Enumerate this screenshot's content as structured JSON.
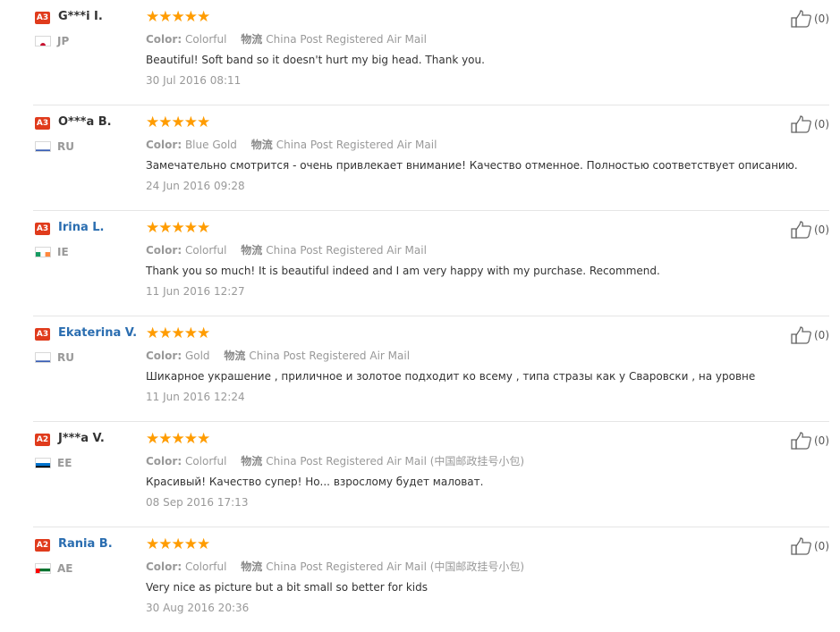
{
  "labels": {
    "color": "Color:",
    "ship_icon": "物流"
  },
  "reviews": [
    {
      "badge": "A3",
      "name": "G***i I.",
      "linked": false,
      "flag": "jp",
      "country": "JP",
      "stars": "★★★★★",
      "color": "Colorful",
      "shipping": "China Post Registered Air Mail",
      "text": "Beautiful! Soft band so it doesn't hurt my big head. Thank you.",
      "date": "30 Jul 2016 08:11",
      "likes": "(0)"
    },
    {
      "badge": "A3",
      "name": "O***a B.",
      "linked": false,
      "flag": "ru",
      "country": "RU",
      "stars": "★★★★★",
      "color": "Blue Gold",
      "shipping": "China Post Registered Air Mail",
      "text": "Замечательно смотрится - очень привлекает внимание! Качество отменное. Полностью соответствует описанию.",
      "date": "24 Jun 2016 09:28",
      "likes": "(0)"
    },
    {
      "badge": "A3",
      "name": "Irina L.",
      "linked": true,
      "flag": "ie",
      "country": "IE",
      "stars": "★★★★★",
      "color": "Colorful",
      "shipping": "China Post Registered Air Mail",
      "text": "Thank you so much! It is beautiful indeed and I am very happy with my purchase. Recommend.",
      "date": "11 Jun 2016 12:27",
      "likes": "(0)"
    },
    {
      "badge": "A3",
      "name": "Ekaterina V.",
      "linked": true,
      "flag": "ru",
      "country": "RU",
      "stars": "★★★★★",
      "color": "Gold",
      "shipping": "China Post Registered Air Mail",
      "text": "Шикарное украшение , приличное и золотое подходит ко всему , типа стразы как у Сваровски , на уровне",
      "date": "11 Jun 2016 12:24",
      "likes": "(0)"
    },
    {
      "badge": "A2",
      "name": "J***a V.",
      "linked": false,
      "flag": "ee",
      "country": "EE",
      "stars": "★★★★★",
      "color": "Colorful",
      "shipping": "China Post Registered Air Mail (中国邮政挂号小包)",
      "text": "Красивый! Качество супер! Но... взрослому будет маловат.",
      "date": "08 Sep 2016 17:13",
      "likes": "(0)"
    },
    {
      "badge": "A2",
      "name": "Rania B.",
      "linked": true,
      "flag": "ae",
      "country": "AE",
      "stars": "★★★★★",
      "color": "Colorful",
      "shipping": "China Post Registered Air Mail (中国邮政挂号小包)",
      "text": "Very nice as picture but a bit small so better for kids",
      "date": "30 Aug 2016 20:36",
      "likes": "(0)"
    }
  ]
}
